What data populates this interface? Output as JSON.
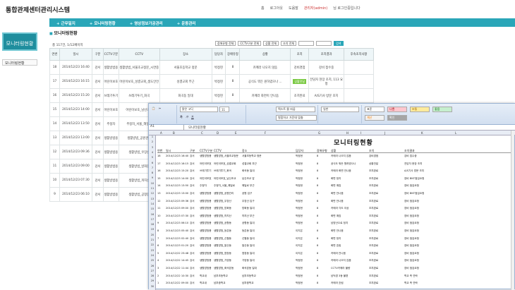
{
  "app": {
    "title": "통합관제센터관리시스템"
  },
  "toplinks": {
    "home": "홈",
    "logout": "로그아웃",
    "help": "도움말",
    "user": "관리자(admin)",
    "greeting": "님 로그인중입니다"
  },
  "nav": {
    "items": [
      "근무일지",
      "모니터링현황",
      "영상정보가공관리",
      "운동관리"
    ]
  },
  "sidebar": {
    "heading": "모니터링현황",
    "items": [
      "모니터링현황"
    ]
  },
  "page": {
    "title": "모니터링현황",
    "total": "총 117건, 1/12페이지"
  },
  "filters": {
    "sel1": "장애유형 전체",
    "sel2": "CCTV구분 전체",
    "sel3": "상황 전체",
    "sel4": "조치 전체",
    "search_btn": "검색"
  },
  "table": {
    "headers": [
      "연번",
      "일시",
      "구분",
      "CCTV구분",
      "CCTV",
      "장소",
      "담당자",
      "장애유형",
      "상황",
      "조치",
      "조치결과",
      "후속조치사항"
    ],
    "rows": [
      {
        "no": "18",
        "date": "2014/12/23 16:40",
        "gu": "강서",
        "type": "생활방범용",
        "cctv": "생활방범_서울초교정문_시연중",
        "place": "서울초등학교 정문",
        "mgr": "박정현",
        "err": "8",
        "situation": "카메라 나오지 않음",
        "action": "강비경점",
        "result": "강비 접수중",
        "follow": ""
      },
      {
        "no": "17",
        "date": "2014/12/23 16:15",
        "gu": "강서",
        "type": "어린이보호",
        "cctv": "어린이보호_성결교회_생도안전",
        "place": "성결교회 부근",
        "mgr": "박정현",
        "err": "8",
        "situation": "공식도 뭐든 원하였으나 ...",
        "action": "상황전달",
        "result": "전담자 현장 조치, 113 요청",
        "follow": ""
      },
      {
        "no": "16",
        "date": "2014/12/23 15:20",
        "gu": "강서",
        "type": "쓰레기투기",
        "cctv": "쓰레기투기_화곡",
        "place": "화곡동 일대",
        "mgr": "박정현",
        "err": "8",
        "situation": "카메라 화면이 안나옴",
        "action": "조치완료",
        "result": "A/S기사 방문 조치",
        "follow": ""
      },
      {
        "no": "15",
        "date": "2014/12/23 14:00",
        "gu": "강서",
        "type": "어린이보호",
        "cctv": "어린이보호_남산초교",
        "place": "",
        "mgr": "",
        "err": "",
        "situation": "",
        "action": "",
        "result": "",
        "follow": ""
      },
      {
        "no": "14",
        "date": "2014/12/23 13:50",
        "gu": "강서",
        "type": "주정차",
        "cctv": "주정차_서울_해일로",
        "place": "",
        "mgr": "",
        "err": "",
        "situation": "",
        "action": "",
        "result": "",
        "follow": ""
      },
      {
        "no": "13",
        "date": "2014/12/23 13:00",
        "gu": "강서",
        "type": "생활방범용",
        "cctv": "생활방범_공원관리",
        "place": "",
        "mgr": "",
        "err": "",
        "situation": "",
        "action": "",
        "result": "",
        "follow": ""
      },
      {
        "no": "12",
        "date": "2014/12/23 09:36",
        "gu": "강서",
        "type": "생활방범용",
        "cctv": "생활방범_우장산",
        "place": "",
        "mgr": "",
        "err": "",
        "situation": "",
        "action": "",
        "result": "",
        "follow": ""
      },
      {
        "no": "11",
        "date": "2014/12/23 09:00",
        "gu": "강서",
        "type": "생활방범용",
        "cctv": "생활방범_방화동",
        "place": "",
        "mgr": "",
        "err": "",
        "situation": "",
        "action": "",
        "result": "",
        "follow": ""
      },
      {
        "no": "10",
        "date": "2014/12/23 07:30",
        "gu": "강서",
        "type": "생활방범용",
        "cctv": "생활방범_까치산",
        "place": "",
        "mgr": "",
        "err": "",
        "situation": "",
        "action": "",
        "result": "",
        "follow": ""
      },
      {
        "no": "9",
        "date": "2014/12/23 06:10",
        "gu": "강서",
        "type": "생활방범용",
        "cctv": "생활방범_공항동",
        "place": "",
        "mgr": "",
        "err": "",
        "situation": "",
        "action": "",
        "result": "",
        "follow": ""
      }
    ]
  },
  "excel": {
    "cellref": "A1",
    "formula": "모니터링현황",
    "font": "맑은 고딕",
    "fontsize": "11",
    "numfmt": "일반",
    "wrap": "텍스트 줄 바꿈",
    "merge": "병합하고 가운데 맞춤",
    "styles": {
      "normal": "표준",
      "bad": "나쁨",
      "good": "보통",
      "neutral": "좋음",
      "calc": "계산",
      "check": "확인"
    },
    "sheet_title": "모니터링현황",
    "columns": [
      "A",
      "B",
      "C",
      "D",
      "E",
      "F",
      "G",
      "H",
      "I",
      "J",
      "K",
      "L"
    ],
    "headers": [
      "연번",
      "일시",
      "구분",
      "CCTV구분",
      "CCTV",
      "장소",
      "담당자",
      "장애유형",
      "상황",
      "조치",
      "조치결과"
    ],
    "rows": [
      [
        "18",
        "2014/12/23 16:40",
        "강서",
        "생활방범용",
        "생활방범_서울초교정문",
        "서울초등학교 정문",
        "박정현",
        "8",
        "카메라 나오지 않음",
        "강비경점",
        "강비 접수중"
      ],
      [
        "17",
        "2014/12/23 16:15",
        "강서",
        "어린이보호",
        "어린이보호_성결교회",
        "성결교회 부근",
        "박정현",
        "8",
        "공식도 뭐든 원하였으나",
        "상황전달",
        "전담자 현장 조치"
      ],
      [
        "16",
        "2014/12/23 15:20",
        "강서",
        "쓰레기투기",
        "쓰레기투기_화곡",
        "화곡동 일대",
        "박정현",
        "8",
        "카메라 화면 안나옴",
        "조치완료",
        "A/S기사 방문 조치"
      ],
      [
        "15",
        "2014/12/23 14:00",
        "강서",
        "어린이보호",
        "어린이보호_남산초교",
        "남산초교 앞",
        "박정현",
        "8",
        "화면 정지",
        "조치완료",
        "장비 BNT점검요청"
      ],
      [
        "14",
        "2014/12/23 13:50",
        "강서",
        "주정차",
        "주정차_서울_해일로",
        "해일로 부근",
        "박정현",
        "8",
        "화면 깨짐",
        "조치완료",
        "장비 점검요청"
      ],
      [
        "13",
        "2014/12/23 13:00",
        "강서",
        "생활방범용",
        "생활방범_공원관리",
        "공원 입구",
        "박정현",
        "8",
        "화면 안나옴",
        "조치완료",
        "장비 BNT점검요청"
      ],
      [
        "12",
        "2014/12/23 09:36",
        "강서",
        "생활방범용",
        "생활방범_우장산",
        "우장산 입구",
        "박정현",
        "8",
        "화면 안나옴",
        "조치완료",
        "장비 점검요청"
      ],
      [
        "11",
        "2014/12/23 09:00",
        "강서",
        "생활방범용",
        "생활방범_방화동",
        "방화동 일대",
        "박정현",
        "8",
        "카메라 각도 이상",
        "조치완료",
        "장비 점검요청"
      ],
      [
        "10",
        "2014/12/23 07:30",
        "강서",
        "생활방범용",
        "생활방범_까치산",
        "까치산 부근",
        "박정현",
        "8",
        "화면 깨짐",
        "조치완료",
        "장비 점검요청"
      ],
      [
        "9",
        "2014/12/23 06:10",
        "강서",
        "생활방범용",
        "생활방범_공항동",
        "공항동 일대",
        "박정현",
        "8",
        "남양산으로 정지",
        "조치완료",
        "장비 점검요청"
      ],
      [
        "8",
        "2014/12/23 05:40",
        "강서",
        "생활방범용",
        "생활방범_등촌동",
        "등촌동 일대",
        "이지은",
        "8",
        "화면 안나옴",
        "조치완료",
        "장비 점검요청"
      ],
      [
        "7",
        "2014/12/23 02:40",
        "강서",
        "생활방범용",
        "생활방범_신월동",
        "신월동 일대",
        "이지은",
        "8",
        "화면 정지",
        "조치완료",
        "장비 점검요청"
      ],
      [
        "6",
        "2014/12/23 01:20",
        "강서",
        "생활방범용",
        "생활방범_발산동",
        "발산동 일대",
        "이지은",
        "8",
        "화면 흐림",
        "조치완료",
        "장비 점검요청"
      ],
      [
        "5",
        "2014/12/22 23:48",
        "강서",
        "생활방범용",
        "생활방범_염창동",
        "염창동 일대",
        "이지은",
        "8",
        "카메라 안나옴",
        "조치완료",
        "장비 점검요청"
      ],
      [
        "4",
        "2014/12/22 14:45",
        "강서",
        "생활방범용",
        "생활방범_가양동",
        "가양동 일대",
        "박정현",
        "8",
        "카메라 나오지 않음",
        "조치완료",
        "장비 점검요청"
      ],
      [
        "3",
        "2014/12/22 11:44",
        "강서",
        "생활방범용",
        "생활방범_화곡본동",
        "화곡본동 일대",
        "박정현",
        "8",
        "CCTV카메라 불량",
        "조치완료",
        "장비 점검요청"
      ],
      [
        "2",
        "2014/12/22 10:30",
        "강서",
        "학교내",
        "남부초등학교",
        "남부초등학교",
        "박정현",
        "8",
        "남덕경 3동 불편",
        "조치완료",
        "학교 측 연락"
      ],
      [
        "1",
        "2014/12/22 09:00",
        "강서",
        "학교내",
        "남부중학교",
        "남부중학교",
        "박정현",
        "8",
        "카메라 흐림",
        "조치완료",
        "학교 측 연락"
      ]
    ]
  }
}
